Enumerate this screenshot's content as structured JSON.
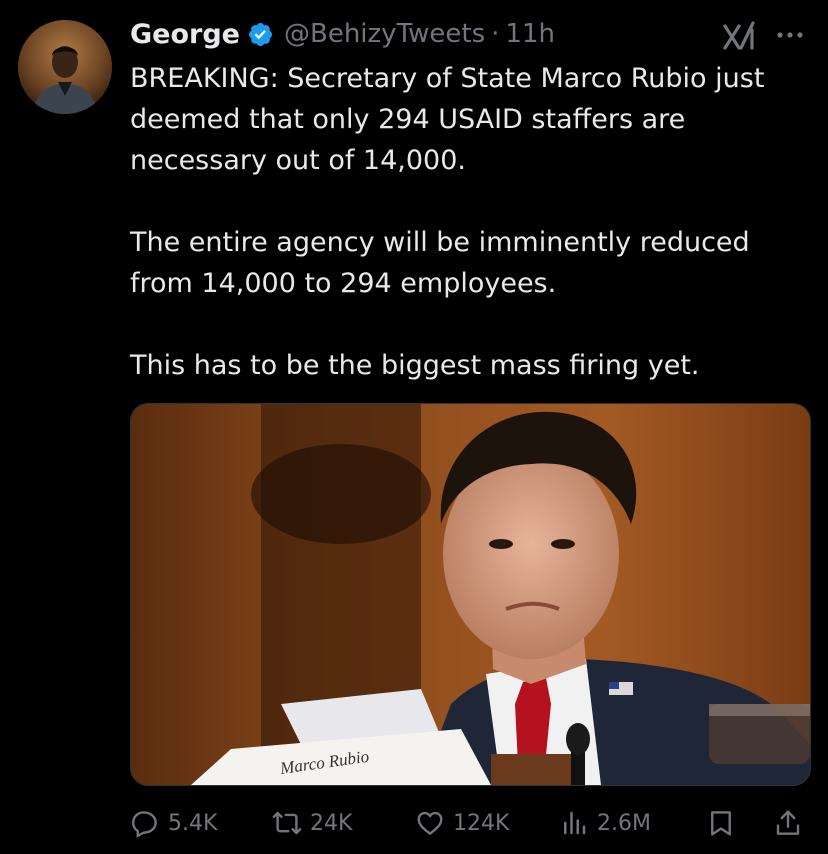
{
  "author": {
    "name": "George",
    "handle": "@BehizyTweets",
    "separator": "·",
    "time": "11h",
    "verified": true,
    "verified_color": "#1d9bf0"
  },
  "tweet": {
    "paragraphs": [
      [
        "BREAKING: Secretary of State Marco Rubio just",
        "deemed that only 294 USAID staffers are",
        "necessary out of 14,000."
      ],
      [
        "The entire agency will be imminently reduced",
        "from 14,000 to 294 employees."
      ],
      [
        "This has to be the biggest mass firing yet."
      ]
    ]
  },
  "media": {
    "placard_text": "Marco Rubio"
  },
  "actions": {
    "replies": "5.4K",
    "reposts": "24K",
    "likes": "124K",
    "views": "2.6M"
  },
  "icons": {
    "header": [
      "grok-icon",
      "more-options-icon"
    ],
    "actions": [
      "reply-icon",
      "repost-icon",
      "like-icon",
      "views-icon",
      "bookmark-icon",
      "share-icon"
    ]
  },
  "colors": {
    "background": "#000000",
    "text": "#e7e9ea",
    "muted": "#71767b",
    "accent": "#1d9bf0"
  }
}
